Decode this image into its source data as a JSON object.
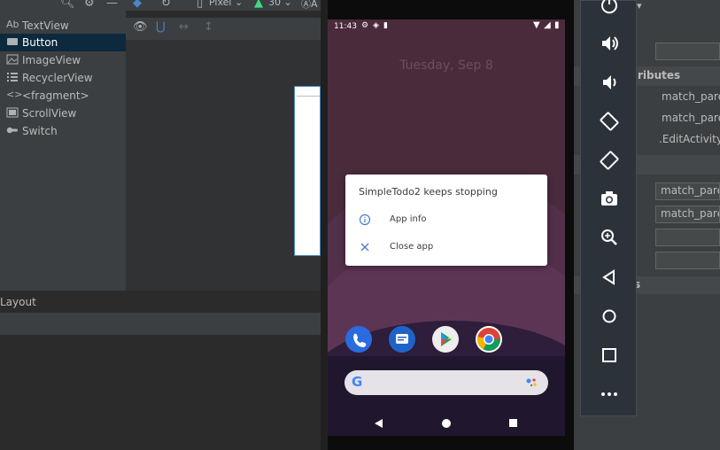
{
  "toolbar": {
    "device": "Pixel",
    "api": "30",
    "extra": "A"
  },
  "palette": {
    "items": [
      {
        "icon": "textview-icon",
        "label": "TextView",
        "glyph": "Ab"
      },
      {
        "icon": "button-icon",
        "label": "Button"
      },
      {
        "icon": "imageview-icon",
        "label": "ImageView"
      },
      {
        "icon": "recyclerview-icon",
        "label": "RecyclerView"
      },
      {
        "icon": "fragment-icon",
        "label": "<fragment>"
      },
      {
        "icon": "scrollview-icon",
        "label": "ScrollView"
      },
      {
        "icon": "switch-icon",
        "label": "Switch"
      }
    ]
  },
  "layout_panel": {
    "title": "Layout"
  },
  "phone": {
    "time": "11:43",
    "date": "Tuesday, Sep 8",
    "dialog": {
      "title": "SimpleTodo2 keeps stopping",
      "options": [
        "App info",
        "Close app"
      ]
    }
  },
  "attributes": {
    "header": "Declared Attributes",
    "header_visible": "ributes",
    "rows": [
      {
        "value": "match_parent"
      },
      {
        "value": "match_parent"
      },
      {
        "value": ".EditActivity"
      }
    ],
    "layout_rows": [
      {
        "value": "match_parent"
      },
      {
        "value": "match_parent"
      },
      {
        "value": ""
      },
      {
        "value": ""
      }
    ],
    "all_attrs_fragment": "s"
  },
  "colors": {
    "ide_bg": "#2b2b2b",
    "panel_bg": "#3c3f41",
    "selection": "#0d293e",
    "accent_blue": "#4a88c7",
    "wallpaper": "#4a2b3c"
  }
}
